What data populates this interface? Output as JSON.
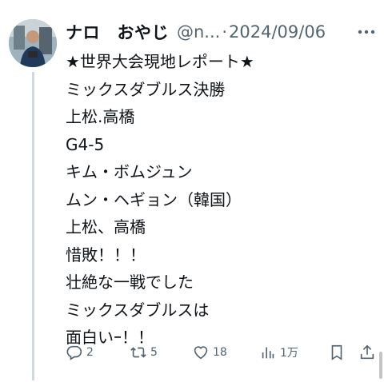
{
  "tweet": {
    "display_name": "ナロ　おやじ",
    "handle": "@n...",
    "separator": "·",
    "date": "2024/09/06",
    "lines": [
      "★世界大会現地レポート★",
      "ミックスダブルス決勝",
      "上松.高橋",
      "G4-5",
      "キム・ボムジュン",
      "ムン・ヘギョン（韓国）",
      "上松、高橋",
      "惜敗！！！",
      "壮絶な一戦でした",
      "ミックスダブルスは",
      "面白いｰ！！"
    ]
  },
  "actions": {
    "reply_count": "2",
    "retweet_count": "5",
    "like_count": "18",
    "views_count": "1万"
  },
  "icons": {
    "more": "more-dots-icon",
    "reply": "reply-icon",
    "retweet": "retweet-icon",
    "like": "heart-icon",
    "views": "views-bar-icon",
    "bookmark": "bookmark-icon",
    "share": "share-icon"
  },
  "colors": {
    "text": "#0f1419",
    "secondary": "#536471",
    "thread_line": "#cfd9de"
  }
}
